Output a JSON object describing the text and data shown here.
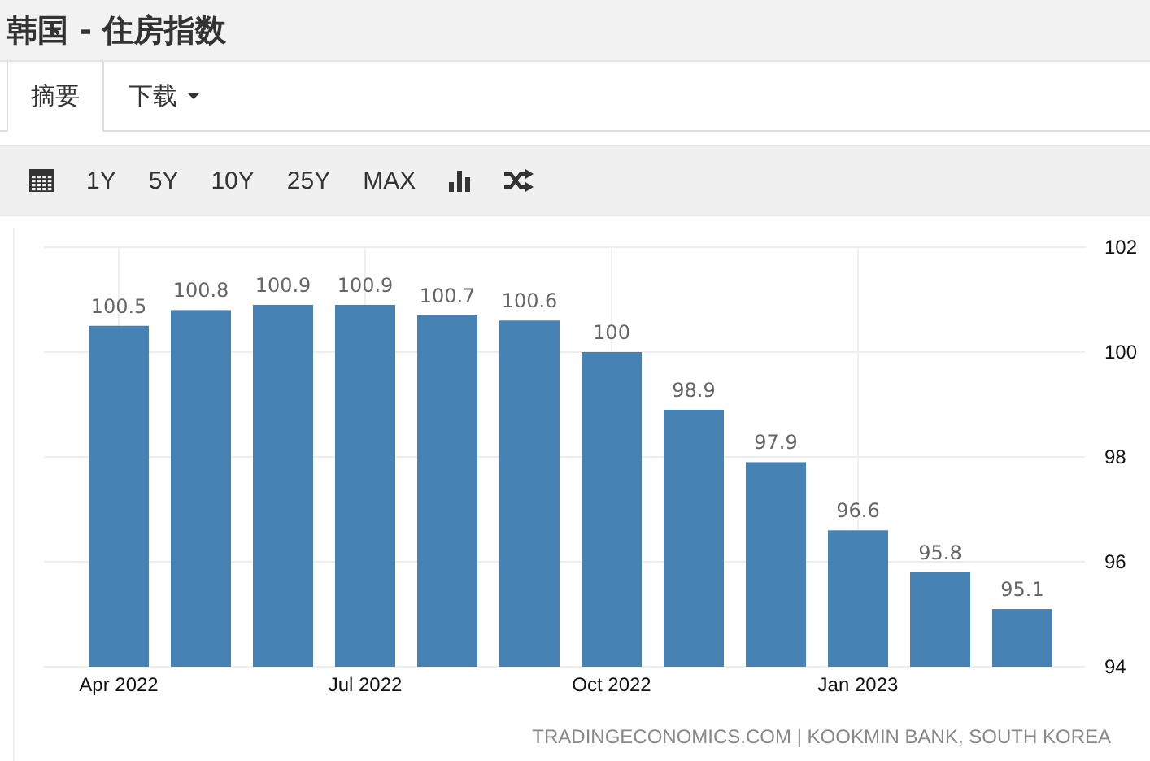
{
  "page_title": "韩国 - 住房指数",
  "tabs": [
    {
      "label": "摘要",
      "selected": true
    },
    {
      "label": "下载",
      "selected": false,
      "dropdown": true
    }
  ],
  "toolbar": [
    {
      "kind": "calendar"
    },
    {
      "kind": "text",
      "label": "1Y"
    },
    {
      "kind": "text",
      "label": "5Y"
    },
    {
      "kind": "text",
      "label": "10Y"
    },
    {
      "kind": "text",
      "label": "25Y"
    },
    {
      "kind": "text",
      "label": "MAX"
    },
    {
      "kind": "bars"
    },
    {
      "kind": "shuffle"
    }
  ],
  "chart": {
    "chart_data": {
      "type": "bar",
      "categories": [
        "Apr 2022",
        null,
        null,
        "Jul 2022",
        null,
        null,
        "Oct 2022",
        null,
        null,
        "Jan 2023",
        null,
        null
      ],
      "series": [
        {
          "color": "#4682b4",
          "values": [
            100.5,
            100.8,
            100.9,
            100.9,
            100.7,
            100.6,
            100,
            98.9,
            97.9,
            96.6,
            95.8,
            95.1
          ]
        }
      ],
      "value_labels": [
        "100.5",
        "100.8",
        "100.9",
        "100.9",
        "100.7",
        "100.6",
        "100",
        "98.9",
        "97.9",
        "96.6",
        "95.8",
        "95.1"
      ],
      "data_labels": true,
      "grid": true,
      "ylim": [
        94,
        102
      ],
      "yticks": [
        94,
        96,
        98,
        100,
        102
      ]
    },
    "source": "TRADINGECONOMICS.COM | KOOKMIN BANK, SOUTH KOREA"
  }
}
